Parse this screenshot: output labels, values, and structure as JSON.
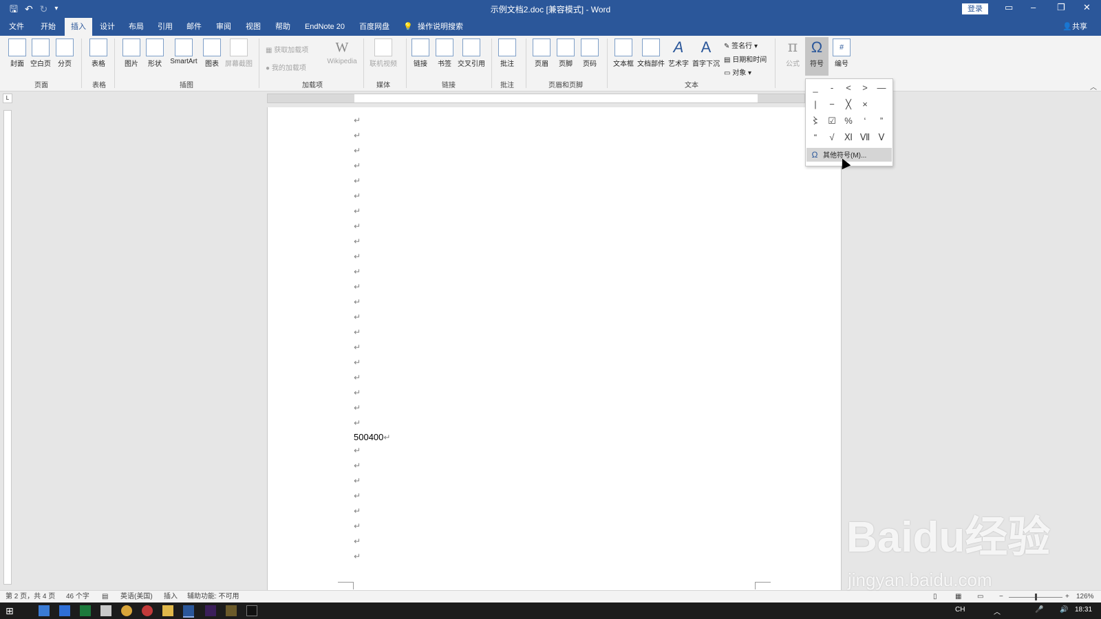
{
  "titlebar": {
    "title": "示例文档2.doc [兼容模式] - Word",
    "login": "登录"
  },
  "tabs": [
    "文件",
    "开始",
    "插入",
    "设计",
    "布局",
    "引用",
    "邮件",
    "审阅",
    "视图",
    "帮助",
    "EndNote 20",
    "百度网盘",
    "操作说明搜索"
  ],
  "active_tab": "插入",
  "share": "共享",
  "ribbon": {
    "buttons": {
      "cover": "封面",
      "blank_page": "空白页",
      "page_break": "分页",
      "table": "表格",
      "picture": "图片",
      "shapes": "形状",
      "smartart": "SmartArt",
      "chart": "图表",
      "screenshot": "屏幕截图",
      "get_addins": "获取加载项",
      "my_addins": "我的加载项",
      "wikipedia": "Wikipedia",
      "online_video": "联机视频",
      "link": "链接",
      "bookmark": "书签",
      "cross_ref": "交叉引用",
      "comment": "批注",
      "header": "页眉",
      "footer": "页脚",
      "page_number": "页码",
      "textbox": "文本框",
      "quick_parts": "文档部件",
      "wordart": "艺术字",
      "dropcap": "首字下沉",
      "signature": "签名行",
      "datetime": "日期和时间",
      "object": "对象",
      "equation": "公式",
      "symbol": "符号",
      "number": "编号"
    },
    "groups": {
      "pages": "页面",
      "tables": "表格",
      "illustrations": "插图",
      "addins": "加载项",
      "media": "媒体",
      "links": "链接",
      "comments": "批注",
      "header_footer": "页眉和页脚",
      "text": "文本"
    }
  },
  "symbol_dropdown": {
    "symbols": [
      "_",
      "-",
      "<",
      ">",
      "—",
      "|",
      "−",
      "╳",
      "×",
      "",
      "〻",
      "☑",
      "%",
      "‘",
      "”",
      "“",
      "√",
      "Ⅺ",
      "Ⅶ",
      "Ⅴ"
    ],
    "more_symbols": "其他符号(M)..."
  },
  "document": {
    "paragraph_mark": "↵",
    "content": "500400"
  },
  "statusbar": {
    "page": "第 2 页，共 4 页",
    "words": "46 个字",
    "language": "英语(美国)",
    "mode": "插入",
    "accessibility": "辅助功能: 不可用",
    "zoom": "126%"
  },
  "taskbar": {
    "ime": "CH",
    "time": "18:31"
  },
  "watermark": {
    "logo": "Baidu经验",
    "url": "jingyan.baidu.com"
  },
  "colors": {
    "accent": "#2b579a",
    "ribbon_bg": "#f3f3f3",
    "canvas_bg": "#e6e6e6"
  }
}
